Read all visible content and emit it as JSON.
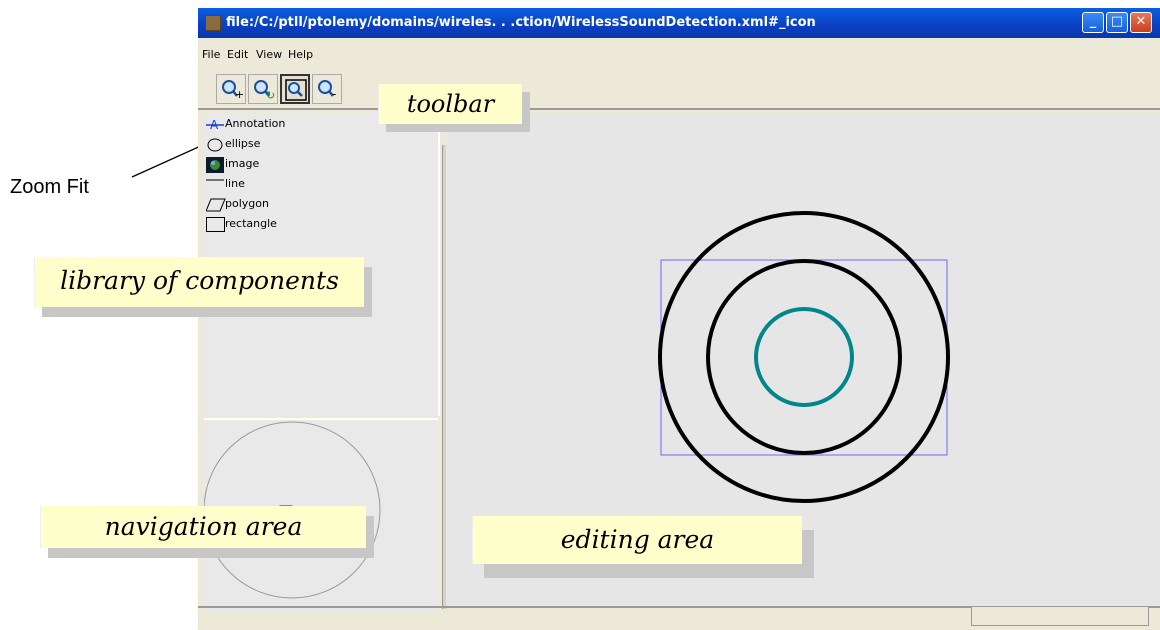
{
  "window": {
    "title": "file:/C:/ptll/ptolemy/domains/wireles. . .ction/WirelessSoundDetection.xml#_icon",
    "controls": {
      "minimize": "_",
      "maximize": "□",
      "close": "✕"
    }
  },
  "menu": [
    "File",
    "Edit",
    "View",
    "Help"
  ],
  "toolbar": {
    "buttons": [
      {
        "icon": "zoom-in-icon",
        "glyph": "+"
      },
      {
        "icon": "zoom-reset-icon",
        "glyph": "↻"
      },
      {
        "icon": "zoom-fit-icon",
        "glyph": ""
      },
      {
        "icon": "zoom-out-icon",
        "glyph": "-"
      }
    ]
  },
  "library": {
    "items": [
      {
        "label": "Annotation",
        "icon": "annotation-icon"
      },
      {
        "label": "ellipse",
        "icon": "ellipse-icon"
      },
      {
        "label": "image",
        "icon": "image-icon"
      },
      {
        "label": "line",
        "icon": "line-icon"
      },
      {
        "label": "polygon",
        "icon": "polygon-icon"
      },
      {
        "label": "rectangle",
        "icon": "rectangle-icon"
      }
    ]
  },
  "annotations": {
    "zoom_fit": "Zoom Fit",
    "toolbar": "toolbar",
    "library": "library of components",
    "navigation": "navigation area",
    "editing": "editing area"
  },
  "colors": {
    "titlebar": "#0a4fd8",
    "callout_bg": "#ffffcc",
    "inner_circle": "#00868b",
    "selection_box": "#6b6bff",
    "nav_viewport": "#ff0000"
  }
}
